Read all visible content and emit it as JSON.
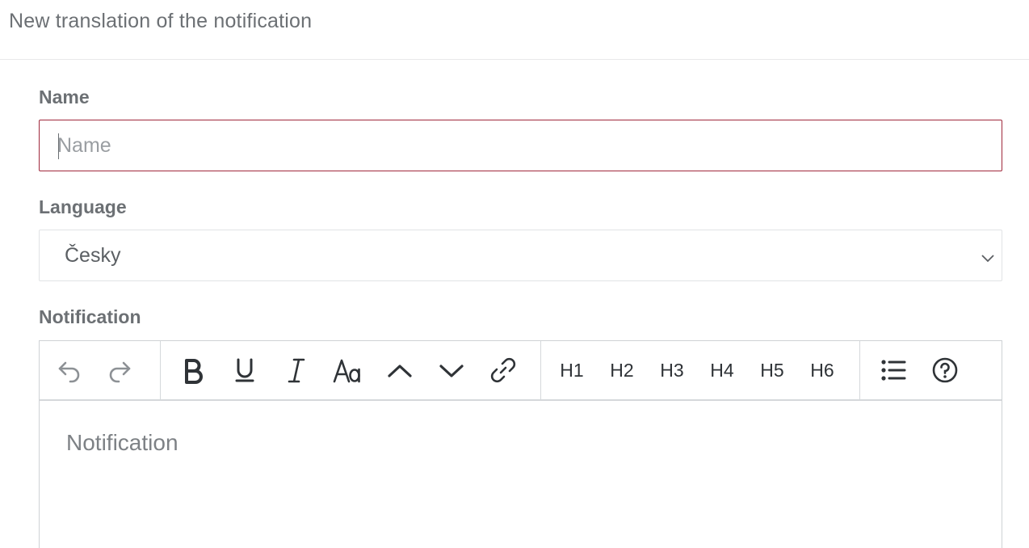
{
  "header": {
    "title": "New translation of the notification"
  },
  "form": {
    "name": {
      "label": "Name",
      "placeholder": "Name",
      "value": ""
    },
    "language": {
      "label": "Language",
      "selected": "Česky"
    },
    "notification": {
      "label": "Notification",
      "placeholder": "Notification"
    }
  },
  "toolbar": {
    "headings": [
      "H1",
      "H2",
      "H3",
      "H4",
      "H5",
      "H6"
    ]
  }
}
